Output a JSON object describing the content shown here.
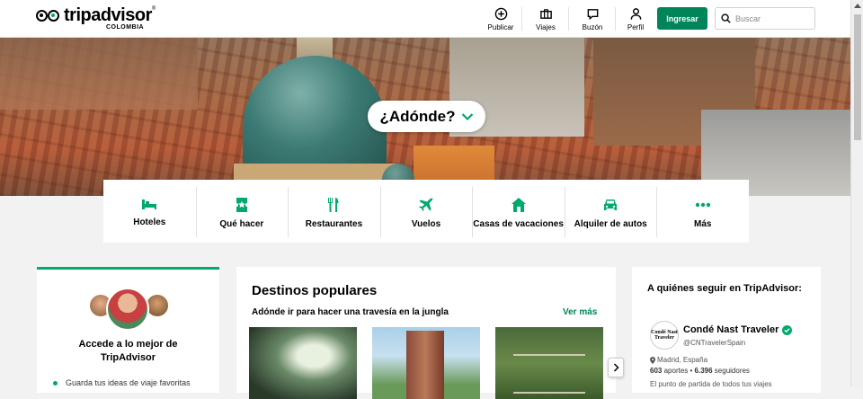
{
  "brand": {
    "name": "tripadvisor",
    "country": "COLOMBIA"
  },
  "nav": {
    "items": [
      {
        "label": "Publicar",
        "icon": "plus-circle-icon"
      },
      {
        "label": "Viajes",
        "icon": "suitcase-icon"
      },
      {
        "label": "Buzón",
        "icon": "message-icon"
      },
      {
        "label": "Perfil",
        "icon": "user-icon"
      }
    ],
    "login_label": "Ingresar",
    "search_placeholder": "Buscar"
  },
  "hero": {
    "where_label": "¿Adónde?"
  },
  "categories": [
    {
      "label": "Hoteles",
      "icon": "bed-icon"
    },
    {
      "label": "Qué hacer",
      "icon": "ticket-icon"
    },
    {
      "label": "Restaurantes",
      "icon": "fork-knife-icon"
    },
    {
      "label": "Vuelos",
      "icon": "plane-icon"
    },
    {
      "label": "Casas de vacaciones",
      "icon": "house-icon"
    },
    {
      "label": "Alquiler de autos",
      "icon": "car-icon"
    },
    {
      "label": "Más",
      "icon": "more-dots-icon"
    }
  ],
  "signup_card": {
    "title": "Accede a lo mejor de TripAdvisor",
    "bullets": [
      "Guarda tus ideas de viaje favoritas"
    ]
  },
  "destinations": {
    "title": "Destinos populares",
    "subtitle": "Adónde ir para hacer una travesía en la jungla",
    "see_more": "Ver más"
  },
  "follow": {
    "title": "A quiénes seguir en TripAdvisor:",
    "account": {
      "name": "Condé Nast Traveler",
      "handle": "@CNTravelerSpain",
      "location": "Madrid, España",
      "contributions": "603",
      "contributions_label": "aportes",
      "followers": "6.396",
      "followers_label": "seguidores",
      "description": "El punto de partida de todos tus viajes",
      "logo_text": "Condé Nast Traveler"
    }
  },
  "colors": {
    "accent": "#00aa6c",
    "button": "#00845a"
  }
}
